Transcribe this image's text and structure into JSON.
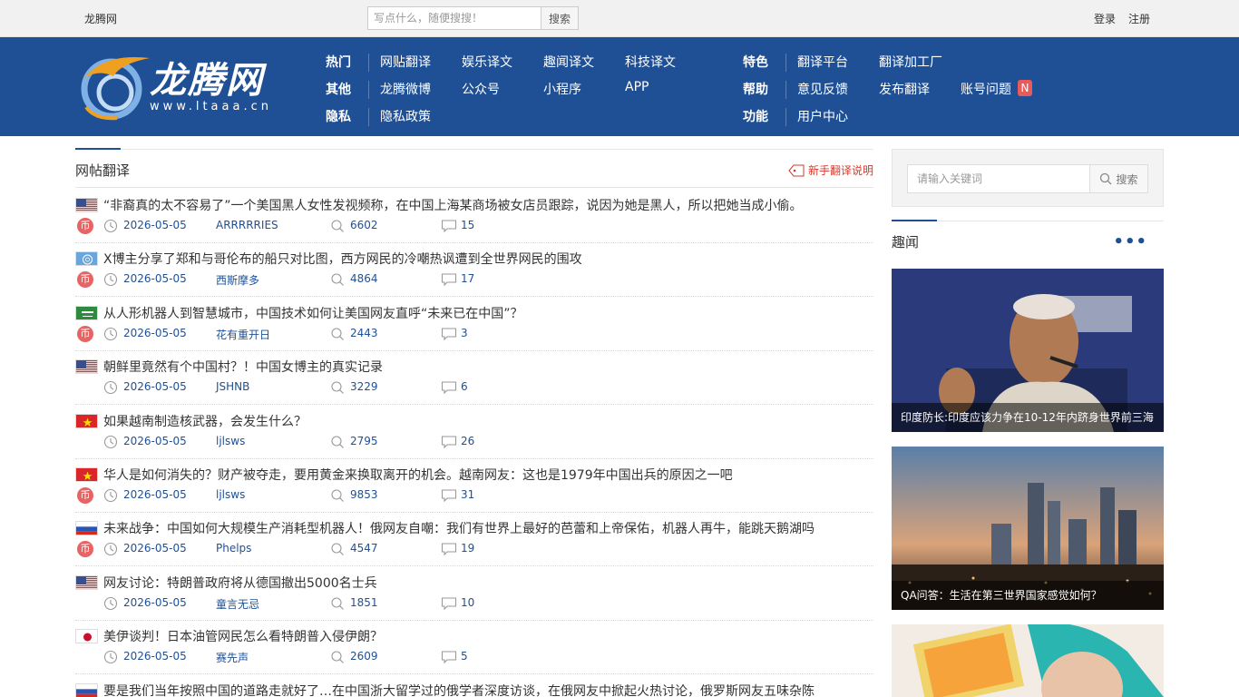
{
  "topbar": {
    "site_name": "龙腾网",
    "search_placeholder": "写点什么，随便搜搜！",
    "search_button": "搜索",
    "login": "登录",
    "register": "注册"
  },
  "logo": {
    "text": "龙腾网",
    "url": "www.ltaaa.cn"
  },
  "nav": {
    "row1": {
      "head": "热门",
      "items": [
        "网贴翻译",
        "娱乐译文",
        "趣闻译文",
        "科技译文"
      ]
    },
    "row2": {
      "head": "其他",
      "items": [
        "龙腾微博",
        "公众号",
        "小程序",
        "APP"
      ]
    },
    "row3": {
      "head": "隐私",
      "items": [
        "隐私政策"
      ]
    },
    "right1": {
      "head": "特色",
      "items": [
        "翻译平台",
        "翻译加工厂"
      ]
    },
    "right2": {
      "head": "帮助",
      "items": [
        "意见反馈",
        "发布翻译",
        "账号问题"
      ],
      "badge": "N"
    },
    "right3": {
      "head": "功能",
      "items": [
        "用户中心"
      ]
    }
  },
  "main": {
    "title": "网帖翻译",
    "guide": "新手翻译说明",
    "coin_label": "币",
    "posts": [
      {
        "flag": "us",
        "title": "“非裔真的太不容易了”一个美国黑人女性发视频称，在中国上海某商场被女店员跟踪，说因为她是黑人，所以把她当成小偷。",
        "coin": true,
        "date": "2026-05-05",
        "user": "ARRRRRIES",
        "views": "6602",
        "comments": "15"
      },
      {
        "flag": "un",
        "title": "X博主分享了郑和与哥伦布的船只对比图，西方网民的冷嘲热讽遭到全世界网民的围攻",
        "coin": true,
        "date": "2026-05-05",
        "user": "西斯摩多",
        "views": "4864",
        "comments": "17"
      },
      {
        "flag": "sa",
        "title": "从人形机器人到智慧城市，中国技术如何让美国网友直呼“未来已在中国”？",
        "coin": true,
        "date": "2026-05-05",
        "user": "花有重开日",
        "views": "2443",
        "comments": "3"
      },
      {
        "flag": "us",
        "title": "朝鲜里竟然有个中国村？！中国女博主的真实记录",
        "coin": false,
        "date": "2026-05-05",
        "user": "JSHNB",
        "views": "3229",
        "comments": "6"
      },
      {
        "flag": "vn",
        "title": "如果越南制造核武器，会发生什么？",
        "coin": false,
        "date": "2026-05-05",
        "user": "ljlsws",
        "views": "2795",
        "comments": "26"
      },
      {
        "flag": "vn",
        "title": "华人是如何消失的？财产被夺走，要用黄金来换取离开的机会。越南网友：这也是1979年中国出兵的原因之一吧",
        "coin": true,
        "date": "2026-05-05",
        "user": "ljlsws",
        "views": "9853",
        "comments": "31"
      },
      {
        "flag": "ru",
        "title": "未来战争：中国如何大规模生产消耗型机器人！俄网友自嘲：我们有世界上最好的芭蕾和上帝保佑，机器人再牛，能跳天鹅湖吗",
        "coin": true,
        "date": "2026-05-05",
        "user": "Phelps",
        "views": "4547",
        "comments": "19"
      },
      {
        "flag": "us",
        "title": "网友讨论：特朗普政府将从德国撤出5000名士兵",
        "coin": false,
        "date": "2026-05-05",
        "user": "童言无忌",
        "views": "1851",
        "comments": "10"
      },
      {
        "flag": "jp",
        "title": "美伊谈判！日本油管网民怎么看特朗普入侵伊朗？",
        "coin": false,
        "date": "2026-05-05",
        "user": "赛先声",
        "views": "2609",
        "comments": "5"
      },
      {
        "flag": "ru",
        "title": "要是我们当年按照中国的道路走就好了…在中国浙大留学过的俄学者深度访谈，在俄网友中掀起火热讨论，俄罗斯网友五味杂陈",
        "coin": false,
        "date": "",
        "user": "",
        "views": "",
        "comments": ""
      }
    ]
  },
  "sidebar": {
    "search_placeholder": "请输入关键词",
    "search_button": "搜索",
    "section_title": "趣闻",
    "more": "•••",
    "cards": [
      {
        "caption": "印度防长:印度应该力争在10-12年内跻身世界前三海"
      },
      {
        "caption": "QA问答：生活在第三世界国家感觉如何？"
      },
      {
        "caption": ""
      }
    ]
  }
}
